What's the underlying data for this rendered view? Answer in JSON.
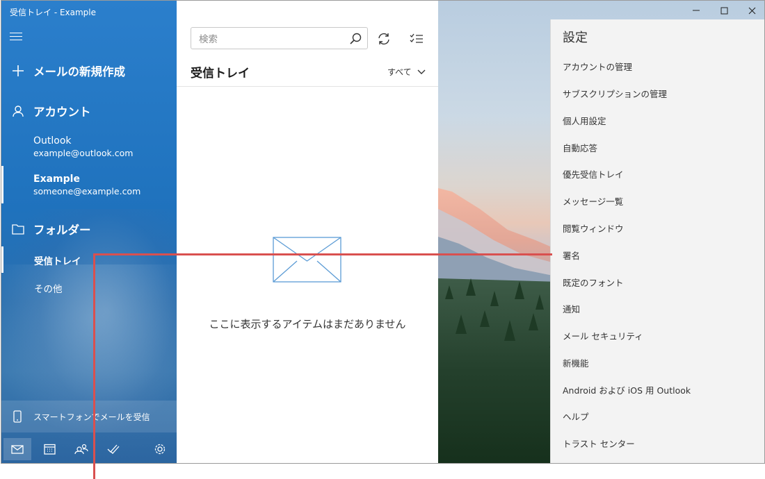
{
  "window": {
    "title": "受信トレイ - Example"
  },
  "nav": {
    "new_mail": "メールの新規作成",
    "accounts_heading": "アカウント",
    "accounts": [
      {
        "name": "Outlook",
        "email": "example@outlook.com",
        "selected": false
      },
      {
        "name": "Example",
        "email": "someone@example.com",
        "selected": true
      }
    ],
    "folders_heading": "フォルダー",
    "folders": [
      {
        "label": "受信トレイ",
        "selected": true
      },
      {
        "label": "その他",
        "selected": false
      }
    ],
    "promo": "スマートフォンでメールを受信",
    "bottom_icons": [
      "mail-icon",
      "calendar-icon",
      "people-icon",
      "todo-icon",
      "settings-icon"
    ]
  },
  "list": {
    "search_placeholder": "検索",
    "title": "受信トレイ",
    "filter": "すべて",
    "empty_message": "ここに表示するアイテムはまだありません"
  },
  "settings": {
    "title": "設定",
    "items": [
      "アカウントの管理",
      "サブスクリプションの管理",
      "個人用設定",
      "自動応答",
      "優先受信トレイ",
      "メッセージ一覧",
      "閲覧ウィンドウ",
      "署名",
      "既定のフォント",
      "通知",
      "メール セキュリティ",
      "新機能",
      "Android および iOS 用 Outlook",
      "ヘルプ",
      "トラスト センター"
    ]
  },
  "colors": {
    "nav_blue": "#1f72bd",
    "annotation": "#d9504f",
    "settings_bg": "#f3f3f3"
  }
}
